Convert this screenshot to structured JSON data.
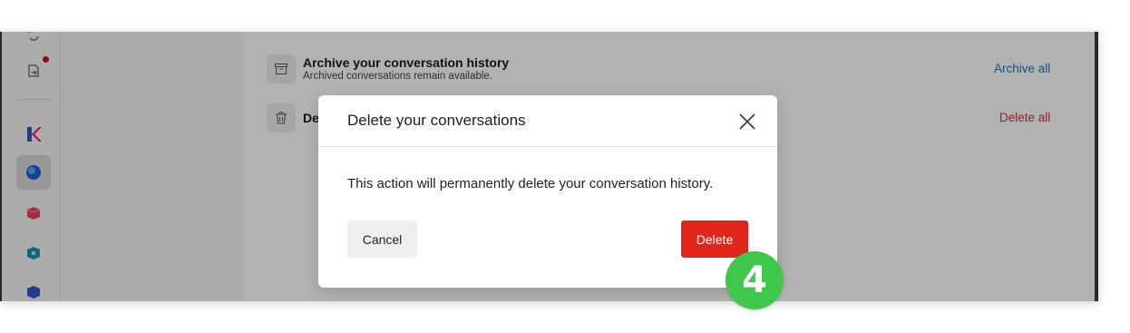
{
  "settings": {
    "archive": {
      "title": "Archive your conversation history",
      "subtitle": "Archived conversations remain available.",
      "action": "Archive all"
    },
    "delete": {
      "title_partial": "De",
      "action": "Delete all"
    }
  },
  "dialog": {
    "title": "Delete your conversations",
    "message": "This action will permanently delete your conversation history.",
    "cancel_label": "Cancel",
    "delete_label": "Delete"
  },
  "annotation": {
    "step": "4"
  },
  "sidebar": {
    "icons": [
      "sync-icon",
      "notifications-icon",
      "app-k-icon",
      "app-globe-icon",
      "app-pink-cube-icon",
      "app-teal-cube-icon",
      "app-blue-cube-icon"
    ]
  },
  "colors": {
    "link_blue": "#1a73c8",
    "danger_red": "#e1251b",
    "badge_green": "#3fc74c",
    "overlay": "rgba(0,0,0,0.30)"
  }
}
